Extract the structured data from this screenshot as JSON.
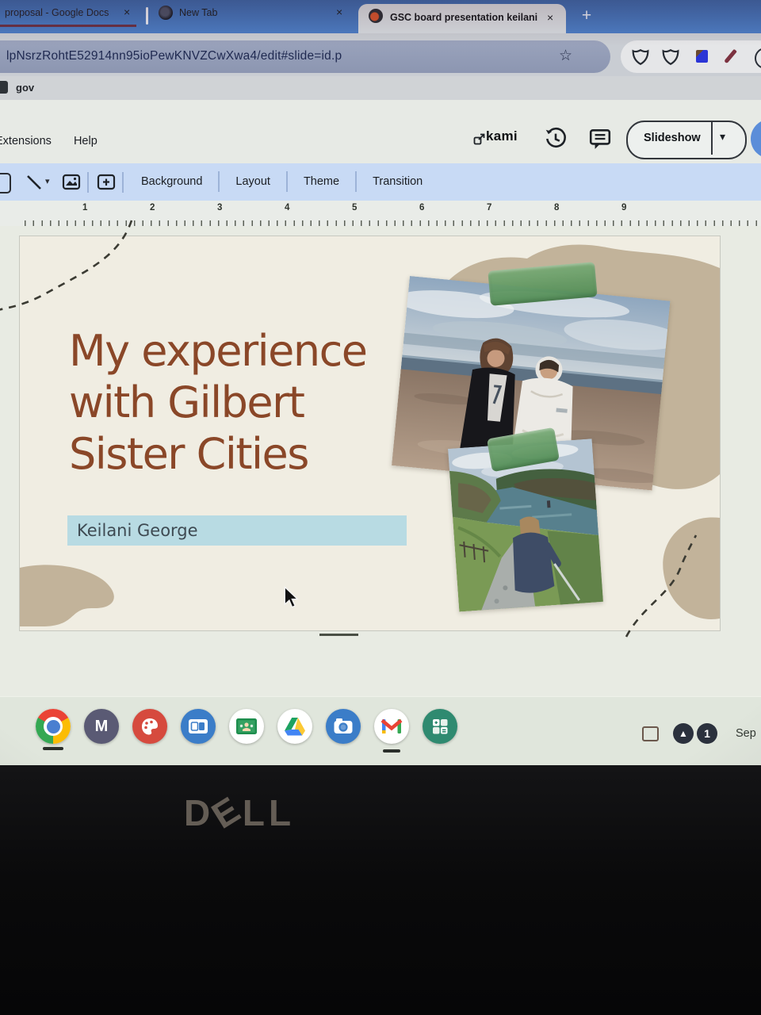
{
  "browser": {
    "tab_strip": {
      "tabs": [
        {
          "title": "proposal - Google Docs",
          "close": "×"
        },
        {
          "title": "New Tab",
          "close": "×"
        },
        {
          "title": "GSC board presentation keilani",
          "close": "×"
        }
      ],
      "new_tab_button": "+"
    },
    "address_bar": {
      "url": "lpNsrzRohtE52914nn95ioPewKNVZCwXwa4/edit#slide=id.p",
      "bookmark_star": "☆"
    },
    "extension_icons": [
      "shield-icon",
      "shield-icon",
      "cube-icon",
      "pencil-icon",
      "profile-icon"
    ],
    "bookmarks_bar": {
      "items": [
        {
          "label": "gov"
        }
      ]
    }
  },
  "slides_app": {
    "menu": {
      "items": [
        "Extensions",
        "Help"
      ]
    },
    "header_right": {
      "kami_label": "kami",
      "icons": [
        "external-link-icon",
        "history-icon",
        "comment-icon"
      ],
      "slideshow_label": "Slideshow",
      "caret": "▾"
    },
    "toolbar": {
      "icons": [
        "select-icon",
        "line-tool-icon",
        "image-icon",
        "text-box-icon"
      ],
      "caret": "▾",
      "buttons": [
        "Background",
        "Layout",
        "Theme",
        "Transition"
      ]
    },
    "ruler": {
      "numbers": [
        "1",
        "2",
        "3",
        "4",
        "5",
        "6",
        "7",
        "8",
        "9"
      ]
    }
  },
  "slide": {
    "title_lines": [
      "My experience",
      "with Gilbert",
      "Sister Cities"
    ],
    "subtitle": "Keilani George",
    "colors": {
      "title_brown": "#8a4728",
      "highlight_blue": "#9ed0e4",
      "blob_tan": "#beae94",
      "tape_green": "#5f9c5c",
      "slide_background": "#f0ede2"
    },
    "photos": [
      "beach-photo-two-girls",
      "cliff-path-photo"
    ]
  },
  "shelf": {
    "app_icons": [
      "chrome",
      "m-app",
      "canvas-app",
      "screencast-app",
      "classroom-app",
      "drive-app",
      "camera-app",
      "gmail-app",
      "calculator-app"
    ],
    "m_letter": "M",
    "status": {
      "up_arrow": "▲",
      "notification_count": "1",
      "date": "Sep"
    }
  },
  "laptop": {
    "brand_d": "D",
    "brand_e": "E",
    "brand_ll": "LL"
  }
}
